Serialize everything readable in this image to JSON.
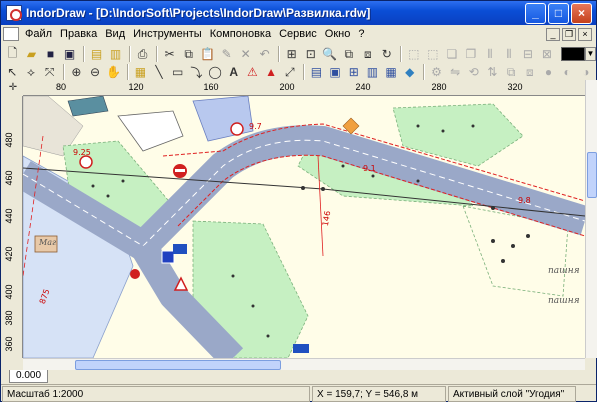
{
  "window": {
    "title": "IndorDraw - [D:\\IndorSoft\\Projects\\IndorDraw\\Развилка.rdw]",
    "buttons": {
      "minimize": "_",
      "maximize": "□",
      "close": "×"
    }
  },
  "menu": {
    "items": [
      "Файл",
      "Правка",
      "Вид",
      "Инструменты",
      "Компоновка",
      "Сервис",
      "Окно",
      "?"
    ]
  },
  "rulers": {
    "x_labels": [
      "80",
      "120",
      "160",
      "200",
      "240",
      "280",
      "320"
    ],
    "y_labels": [
      "480",
      "460",
      "440",
      "420",
      "400",
      "380",
      "360"
    ]
  },
  "map": {
    "labels": {
      "road_dim_1": "9.25",
      "road_dim_2": "9.7",
      "road_dim_3": "9.1",
      "road_dim_4": "9.8",
      "marker_146": "146",
      "station_875": "875",
      "field_label_1": "пашня",
      "field_label_2": "пашня",
      "building_label": "Маг"
    },
    "colors": {
      "background": "#fffde8",
      "road": "#9aa8c8",
      "green_area": "#c6f0c2",
      "building": "#c8c8c8",
      "red_line": "#e02020",
      "blue_zone": "#b8c8ee"
    }
  },
  "sheet": {
    "tab_label": "0.000"
  },
  "status": {
    "scale": "Масштаб 1:2000",
    "coords": "X = 159,7; Y = 546,8  м",
    "layer": "Активный слой \"Угодия\""
  }
}
